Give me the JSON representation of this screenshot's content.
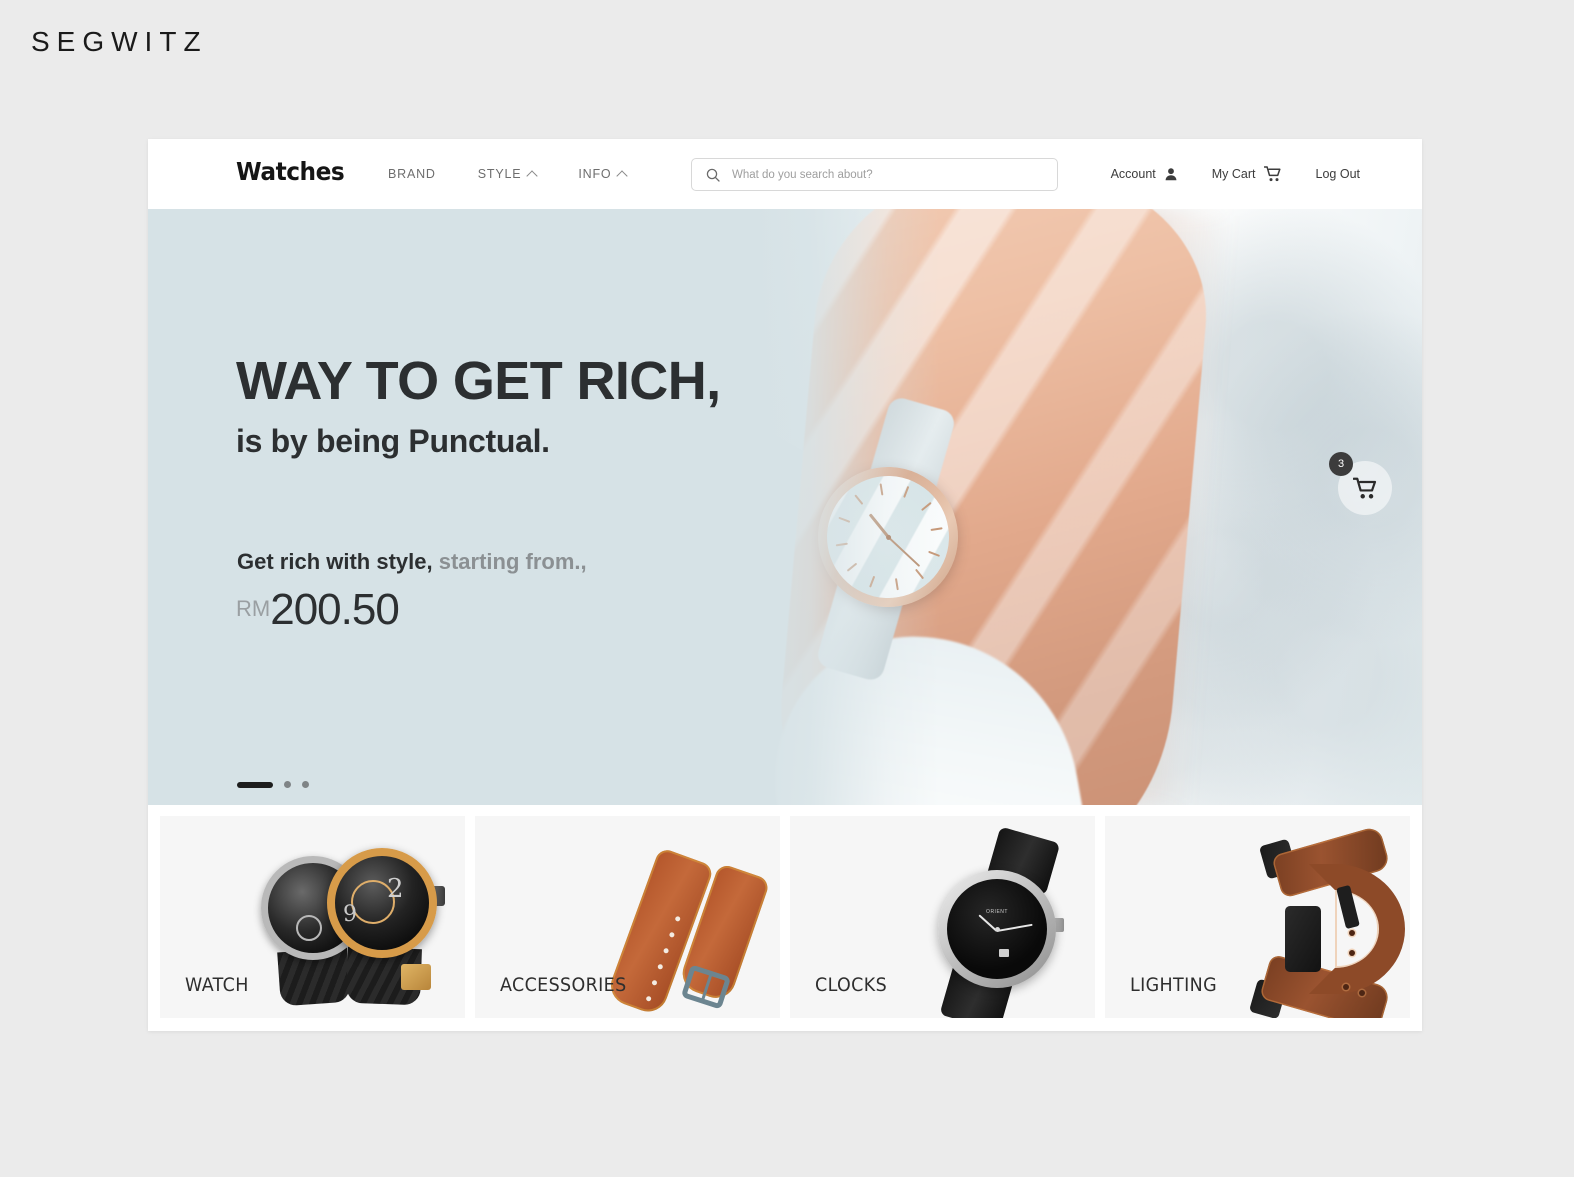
{
  "watermark": "SEGWITZ",
  "nav": {
    "logo": "Watches",
    "links": [
      {
        "label": "BRAND",
        "icon": "",
        "has_chevron": false
      },
      {
        "label": "STYLE",
        "icon": "chevron-up-icon",
        "has_chevron": true
      },
      {
        "label": "INFO",
        "icon": "chevron-up-icon",
        "has_chevron": true
      }
    ],
    "search": {
      "placeholder": "What do you search about?",
      "value": "",
      "icon": "search-icon"
    },
    "right": [
      {
        "label": "Account",
        "icon": "person-icon"
      },
      {
        "label": "My Cart",
        "icon": "cart-icon"
      },
      {
        "label": "Log Out",
        "icon": ""
      }
    ]
  },
  "hero": {
    "headline": "WAY TO GET RICH,",
    "subheadline": "is by being Punctual.",
    "price_lead_strong": "Get rich with style,",
    "price_lead_muted": " starting from.,",
    "currency": "RM",
    "price": "200.50",
    "carousel": {
      "slides": 3,
      "active_index": 0
    },
    "floating_cart": {
      "badge_count": "3",
      "icon": "cart-icon"
    },
    "background_color": "#d6e2e6"
  },
  "categories": [
    {
      "label": "WATCH",
      "art": "twin-luxury-watches"
    },
    {
      "label": "ACCESSORIES",
      "art": "brown-leather-strap"
    },
    {
      "label": "CLOCKS",
      "art": "silver-black-dress-watch"
    },
    {
      "label": "LIGHTING",
      "art": "brown-strap-black-buckle"
    }
  ],
  "colors": {
    "page_background": "#ebebeb",
    "card_background": "#ffffff",
    "hero_panel": "#d6e2e6",
    "text_dark": "#2c2f31",
    "text_muted": "#8b9093",
    "category_tile": "#f6f6f6"
  }
}
